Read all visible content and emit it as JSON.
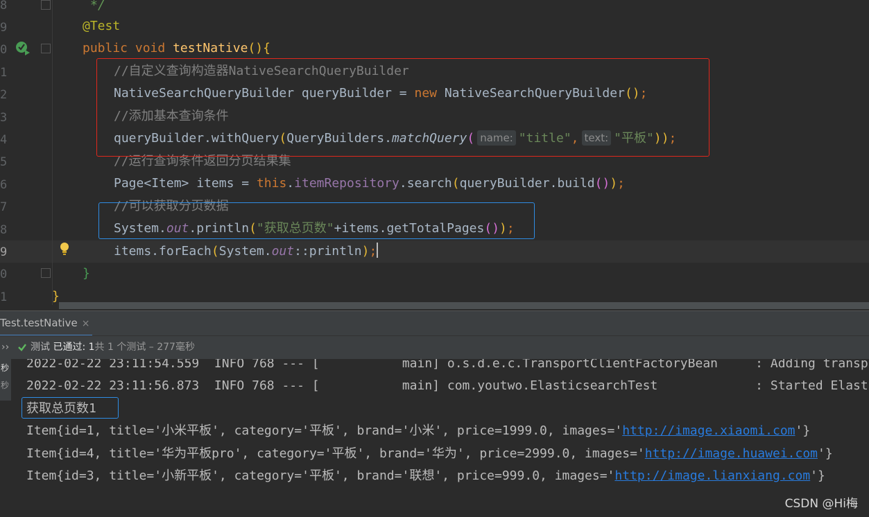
{
  "gutter": {
    "line_numbers": [
      "8",
      "9",
      "0",
      "1",
      "2",
      "3",
      "4",
      "5",
      "6",
      "7",
      "8",
      "9",
      "0",
      "1"
    ]
  },
  "code": {
    "l8_comment_end": "*/",
    "l9_annotation": "@Test",
    "l10_public": "public",
    "l10_void": "void",
    "l10_method": "testNative",
    "l10_paren": "()",
    "l10_brace": "{",
    "l11_comment": "//自定义查询构造器NativeSearchQueryBuilder",
    "l12_type": "NativeSearchQueryBuilder",
    "l12_var": " queryBuilder = ",
    "l12_new": "new",
    "l12_ctor": " NativeSearchQueryBuilder",
    "l12_paren": "()",
    "l12_semi": ";",
    "l13_comment": "//添加基本查询条件",
    "l14_call": "queryBuilder.withQuery",
    "l14_open": "(",
    "l14_class": "QueryBuilders.",
    "l14_method": "matchQuery",
    "l14_open2": "(",
    "l14_hint_name": "name:",
    "l14_str1": "\"title\"",
    "l14_comma": ",",
    "l14_hint_text": "text:",
    "l14_str2": "\"平板\"",
    "l14_close": "))",
    "l14_semi": ";",
    "l15_comment": "//运行查询条件返回分页结果集",
    "l16_type": "Page",
    "l16_generic": "<Item>",
    "l16_var": " items = ",
    "l16_this": "this",
    "l16_dot": ".",
    "l16_field": "itemRepository",
    "l16_search": ".search",
    "l16_open": "(",
    "l16_build": "queryBuilder.build",
    "l16_paren": "()",
    "l16_close": ")",
    "l16_semi": ";",
    "l17_comment": "//可以获取分页数据",
    "l18_system": "System.",
    "l18_out": "out",
    "l18_println": ".println",
    "l18_open": "(",
    "l18_str": "\"获取总页数\"",
    "l18_rest": "+items.getTotalPages",
    "l18_paren": "()",
    "l18_close": ")",
    "l18_semi": ";",
    "l19_call": "items.forEach",
    "l19_open": "(",
    "l19_system": "System.",
    "l19_out": "out",
    "l19_ref": "::println",
    "l19_close": ")",
    "l19_semi": ";",
    "l20_brace": "}",
    "l21_brace": "}"
  },
  "run_panel": {
    "tab_label": "Test.testNative",
    "tab_close": "×",
    "expand_glyph": "››",
    "status_prefix": "测试 ",
    "status_passed": "已通过: 1",
    "status_rest": "共 1 个测试 – 277毫秒",
    "side_labels": [
      "秒",
      "秒"
    ]
  },
  "console": {
    "lines": [
      "2022-02-22 23:11:54.559  INFO 768 --- [           main] o.s.d.e.c.TransportClientFactoryBean     : Adding transport",
      "2022-02-22 23:11:56.873  INFO 768 --- [           main] com.youtwo.ElasticsearchTest             : Started Elastics",
      "获取总页数1"
    ],
    "items": [
      {
        "prefix": "Item{id=1, title='小米平板', category='平板', brand='小米', price=1999.0, images='",
        "link": "http://image.xiaomi.com",
        "suffix": "'}"
      },
      {
        "prefix": "Item{id=4, title='华为平板pro', category='平板', brand='华为', price=2999.0, images='",
        "link": "http://image.huawei.com",
        "suffix": "'}"
      },
      {
        "prefix": "Item{id=3, title='小新平板', category='平板', brand='联想', price=999.0, images='",
        "link": "http://image.lianxiang.com",
        "suffix": "'}"
      }
    ]
  },
  "watermark": "CSDN @Hi梅",
  "colors": {
    "red_box": "#e0281c",
    "blue_box": "#2f8de4",
    "link": "#287bde"
  }
}
